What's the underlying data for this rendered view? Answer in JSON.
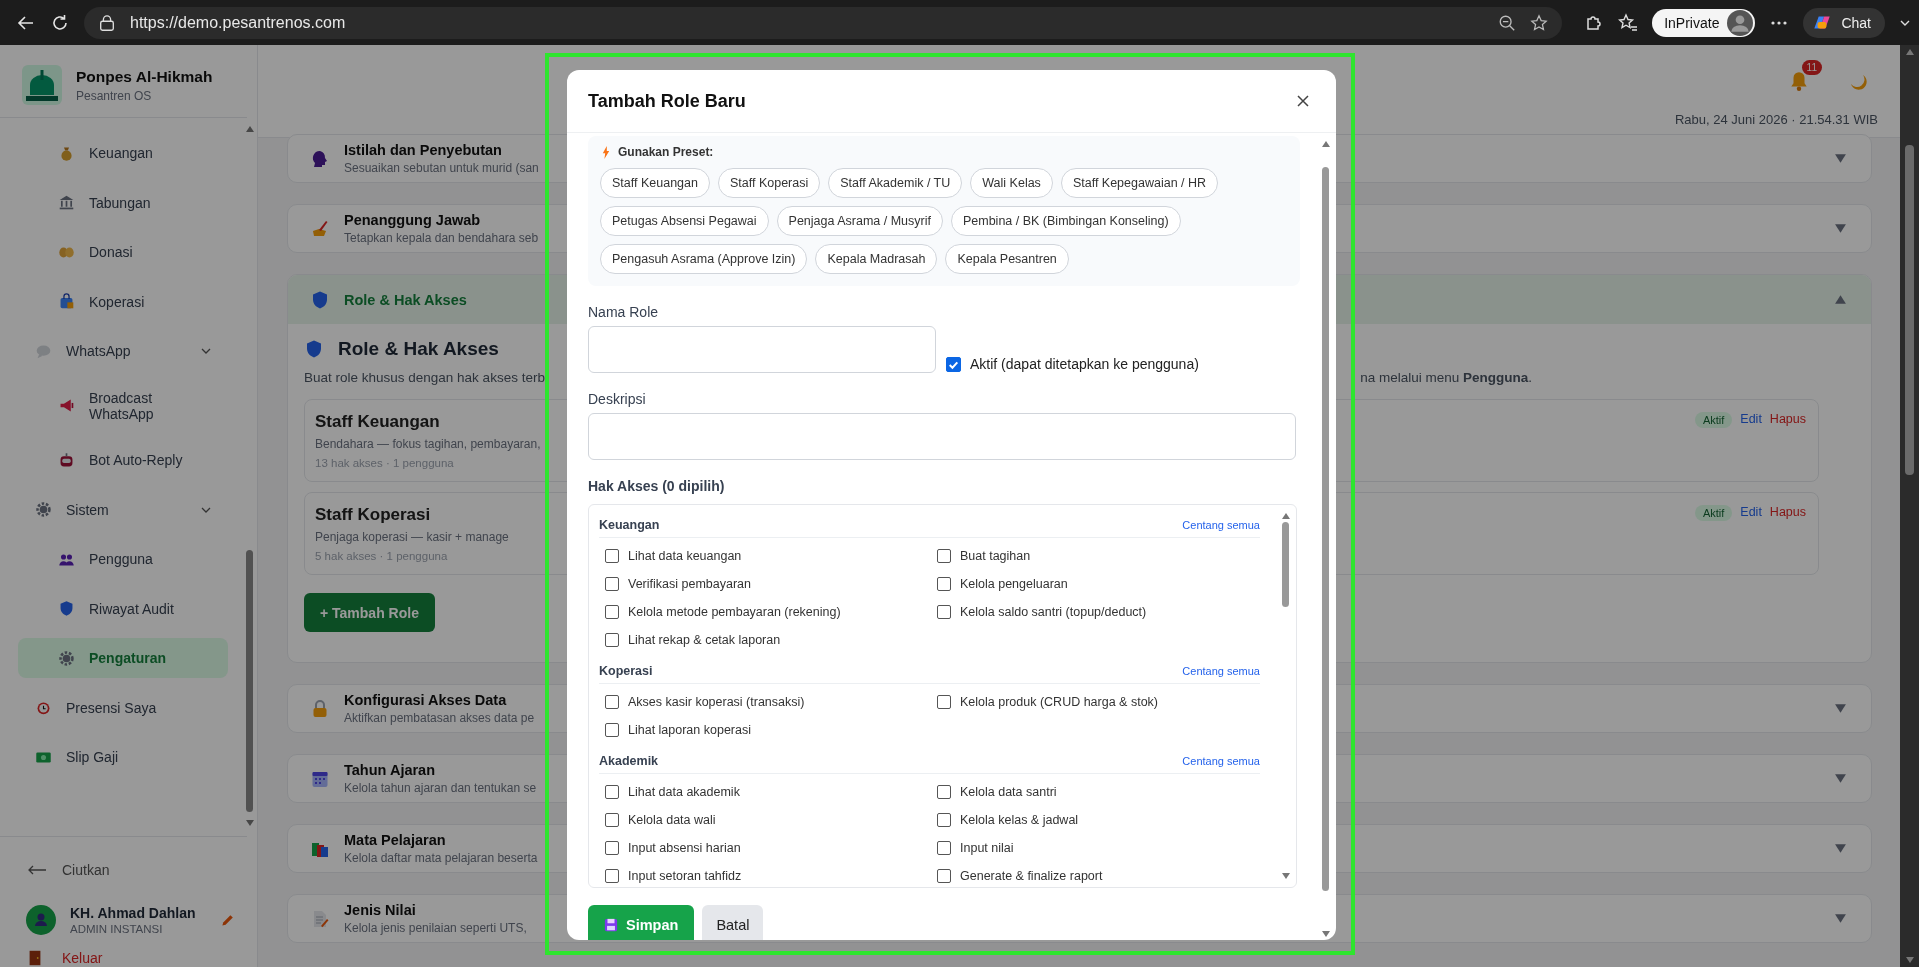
{
  "browser": {
    "url": "https://demo.pesantrenos.com",
    "profile": "InPrivate",
    "chat": "Chat"
  },
  "sidebar": {
    "brand": "Ponpes Al-Hikmah",
    "subtitle": "Pesantren OS",
    "items": [
      {
        "kind": "sub",
        "label": "Keuangan",
        "selected": false
      },
      {
        "kind": "sub",
        "label": "Tabungan",
        "selected": false
      },
      {
        "kind": "sub",
        "label": "Donasi",
        "selected": false
      },
      {
        "kind": "sub",
        "label": "Koperasi",
        "selected": false
      },
      {
        "kind": "group",
        "label": "WhatsApp",
        "selected": false,
        "expanded": true
      },
      {
        "kind": "sub",
        "label": "Broadcast WhatsApp",
        "selected": false
      },
      {
        "kind": "sub",
        "label": "Bot Auto-Reply",
        "selected": false
      },
      {
        "kind": "group",
        "label": "Sistem",
        "selected": false,
        "expanded": true
      },
      {
        "kind": "sub",
        "label": "Pengguna",
        "selected": false
      },
      {
        "kind": "sub",
        "label": "Riwayat Audit",
        "selected": false
      },
      {
        "kind": "sub",
        "label": "Pengaturan",
        "selected": true
      },
      {
        "kind": "top",
        "label": "Presensi Saya",
        "selected": false
      },
      {
        "kind": "top",
        "label": "Slip Gaji",
        "selected": false
      }
    ],
    "collapse": "Ciutkan",
    "user": {
      "name": "KH. Ahmad Dahlan",
      "role": "ADMIN INSTANSI"
    },
    "logout": "Keluar"
  },
  "header": {
    "notifications": "11",
    "datetime": "Rabu, 24 Juni 2026 · 21.54.31 WIB"
  },
  "sections": [
    {
      "title": "Istilah dan Penyebutan",
      "subtitle": "Sesuaikan sebutan untuk murid (san",
      "expanded": false
    },
    {
      "title": "Penanggung Jawab",
      "subtitle": "Tetapkan kepala dan bendahara seb",
      "expanded": false
    },
    {
      "title": "Role & Hak Akses",
      "expanded": true,
      "content": {
        "heading": "Role & Hak Akses",
        "description_start": "Buat role khusus dengan hak akses terb",
        "description_end": "na melalui menu **Pengguna**.",
        "roles": [
          {
            "name": "Staff Keuangan",
            "description": "Bendahara — fokus tagihan, pembayaran,",
            "meta": "13 hak akses · 1 pengguna",
            "status": "Aktif",
            "edit": "Edit",
            "delete": "Hapus"
          },
          {
            "name": "Staff Koperasi",
            "description": "Penjaga koperasi — kasir + manage",
            "meta": "5 hak akses · 1 pengguna",
            "status": "Aktif",
            "edit": "Edit",
            "delete": "Hapus"
          }
        ],
        "add_button": "+ Tambah Role"
      }
    },
    {
      "title": "Konfigurasi Akses Data",
      "subtitle": "Aktifkan pembatasan akses data pe",
      "expanded": false
    },
    {
      "title": "Tahun Ajaran",
      "subtitle": "Kelola tahun ajaran dan tentukan se",
      "expanded": false
    },
    {
      "title": "Mata Pelajaran",
      "subtitle": "Kelola daftar mata pelajaran beserta",
      "expanded": false
    },
    {
      "title": "Jenis Nilai",
      "subtitle": "Kelola jenis penilaian seperti UTS,",
      "expanded": false
    }
  ],
  "modal": {
    "title": "Tambah Role Baru",
    "presets": {
      "label": "Gunakan Preset:",
      "chips": [
        "Staff Keuangan",
        "Staff Koperasi",
        "Staff Akademik / TU",
        "Wali Kelas",
        "Staff Kepegawaian / HR",
        "Petugas Absensi Pegawai",
        "Penjaga Asrama / Musyrif",
        "Pembina / BK (Bimbingan Konseling)",
        "Pengasuh Asrama (Approve Izin)",
        "Kepala Madrasah",
        "Kepala Pesantren"
      ]
    },
    "name_label": "Nama Role",
    "active": {
      "label": "Aktif (dapat ditetapkan ke pengguna)",
      "checked": true
    },
    "description_label": "Deskripsi",
    "permissions": {
      "title": "Hak Akses (0 dipilih)",
      "groups": [
        {
          "name": "Keuangan",
          "select_all": "Centang semua",
          "items": [
            {
              "label": "Lihat data keuangan",
              "checked": false
            },
            {
              "label": "Buat tagihan",
              "checked": false
            },
            {
              "label": "Verifikasi pembayaran",
              "checked": false
            },
            {
              "label": "Kelola pengeluaran",
              "checked": false
            },
            {
              "label": "Kelola metode pembayaran (rekening)",
              "checked": false
            },
            {
              "label": "Kelola saldo santri (topup/deduct)",
              "checked": false
            },
            {
              "label": "Lihat rekap & cetak laporan",
              "checked": false
            }
          ]
        },
        {
          "name": "Koperasi",
          "select_all": "Centang semua",
          "items": [
            {
              "label": "Akses kasir koperasi (transaksi)",
              "checked": false
            },
            {
              "label": "Kelola produk (CRUD harga & stok)",
              "checked": false
            },
            {
              "label": "Lihat laporan koperasi",
              "checked": false
            }
          ]
        },
        {
          "name": "Akademik",
          "select_all": "Centang semua",
          "items": [
            {
              "label": "Lihat data akademik",
              "checked": false
            },
            {
              "label": "Kelola data santri",
              "checked": false
            },
            {
              "label": "Kelola data wali",
              "checked": false
            },
            {
              "label": "Kelola kelas & jadwal",
              "checked": false
            },
            {
              "label": "Input absensi harian",
              "checked": false
            },
            {
              "label": "Input nilai",
              "checked": false
            },
            {
              "label": "Input setoran tahfidz",
              "checked": false
            },
            {
              "label": "Generate & finalize raport",
              "checked": false
            }
          ]
        }
      ]
    },
    "save": "Simpan",
    "cancel": "Batal"
  }
}
